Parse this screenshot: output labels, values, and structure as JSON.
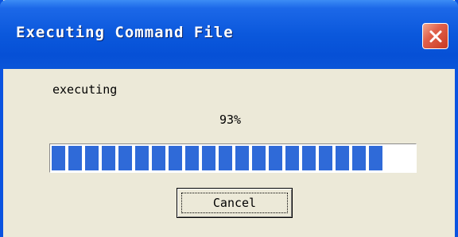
{
  "window": {
    "title": "Executing Command File"
  },
  "status": {
    "label": "executing",
    "percent_text": "93%"
  },
  "progress": {
    "value": 0.93,
    "color": "#2f6ad8"
  },
  "buttons": {
    "cancel_label": "Cancel"
  },
  "icons": {
    "close": "close-icon"
  },
  "colors": {
    "titlebar": "#0b58dc",
    "dialog_bg": "#ece9d8",
    "close_button": "#e0604a"
  }
}
